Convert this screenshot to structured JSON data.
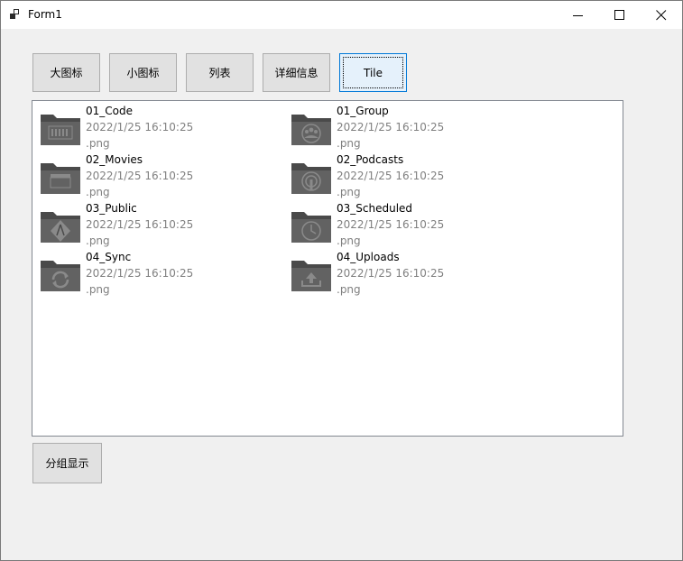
{
  "window": {
    "title": "Form1"
  },
  "toolbar": {
    "large_icon_label": "大图标",
    "small_icon_label": "小图标",
    "list_label": "列表",
    "details_label": "详细信息",
    "tile_label": "Tile"
  },
  "listview": {
    "items": [
      {
        "name": "01_Code",
        "date": "2022/1/25 16:10:25",
        "ext": ".png",
        "icon": "code-folder-icon"
      },
      {
        "name": "01_Group",
        "date": "2022/1/25 16:10:25",
        "ext": ".png",
        "icon": "group-folder-icon"
      },
      {
        "name": "02_Movies",
        "date": "2022/1/25 16:10:25",
        "ext": ".png",
        "icon": "movies-folder-icon"
      },
      {
        "name": "02_Podcasts",
        "date": "2022/1/25 16:10:25",
        "ext": ".png",
        "icon": "podcasts-folder-icon"
      },
      {
        "name": "03_Public",
        "date": "2022/1/25 16:10:25",
        "ext": ".png",
        "icon": "public-folder-icon"
      },
      {
        "name": "03_Scheduled",
        "date": "2022/1/25 16:10:25",
        "ext": ".png",
        "icon": "scheduled-folder-icon"
      },
      {
        "name": "04_Sync",
        "date": "2022/1/25 16:10:25",
        "ext": ".png",
        "icon": "sync-folder-icon"
      },
      {
        "name": "04_Uploads",
        "date": "2022/1/25 16:10:25",
        "ext": ".png",
        "icon": "uploads-folder-icon"
      }
    ]
  },
  "group_button_label": "分组显示",
  "colors": {
    "accent": "#0078d7",
    "folder": "#5a5a5a",
    "secondary_text": "#808080"
  }
}
